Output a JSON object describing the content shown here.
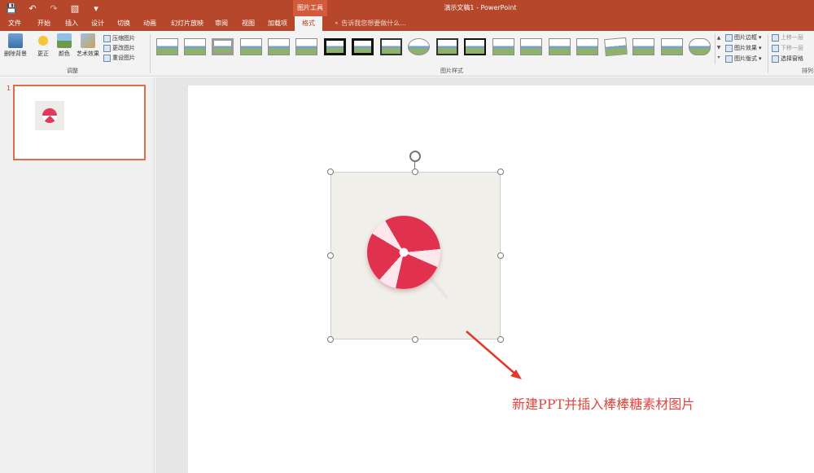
{
  "qat": {
    "save_icon": "save-icon",
    "undo_icon": "undo-icon",
    "redo_icon": "redo-icon",
    "present_icon": "present-icon"
  },
  "title": {
    "context_tools": "图片工具",
    "document": "演示文稿1 - PowerPoint"
  },
  "tabs": [
    "文件",
    "开始",
    "插入",
    "设计",
    "切换",
    "动画",
    "幻灯片放映",
    "审阅",
    "视图",
    "加载项"
  ],
  "active_tab": "格式",
  "tell_me": {
    "placeholder": "告诉我您想要做什么..."
  },
  "ribbon": {
    "remove_bg": "删除背景",
    "corrections": "更正",
    "color": "颜色",
    "artistic": "艺术效果",
    "compress": "压缩图片",
    "change": "更改图片",
    "reset": "重设图片",
    "adjust_group": "调整",
    "styles_group": "图片样式",
    "border": "图片边框",
    "effects": "图片效果",
    "layout": "图片版式",
    "bring_forward": "上移一层",
    "send_backward": "下移一层",
    "selection_pane": "选择窗格",
    "arrange_group": "排列"
  },
  "slides": {
    "number": "1"
  },
  "caption": "新建PPT并插入棒棒糖素材图片",
  "colors": {
    "brand": "#b7472a",
    "arrow": "#e03a2f",
    "caption": "#e0463f"
  }
}
